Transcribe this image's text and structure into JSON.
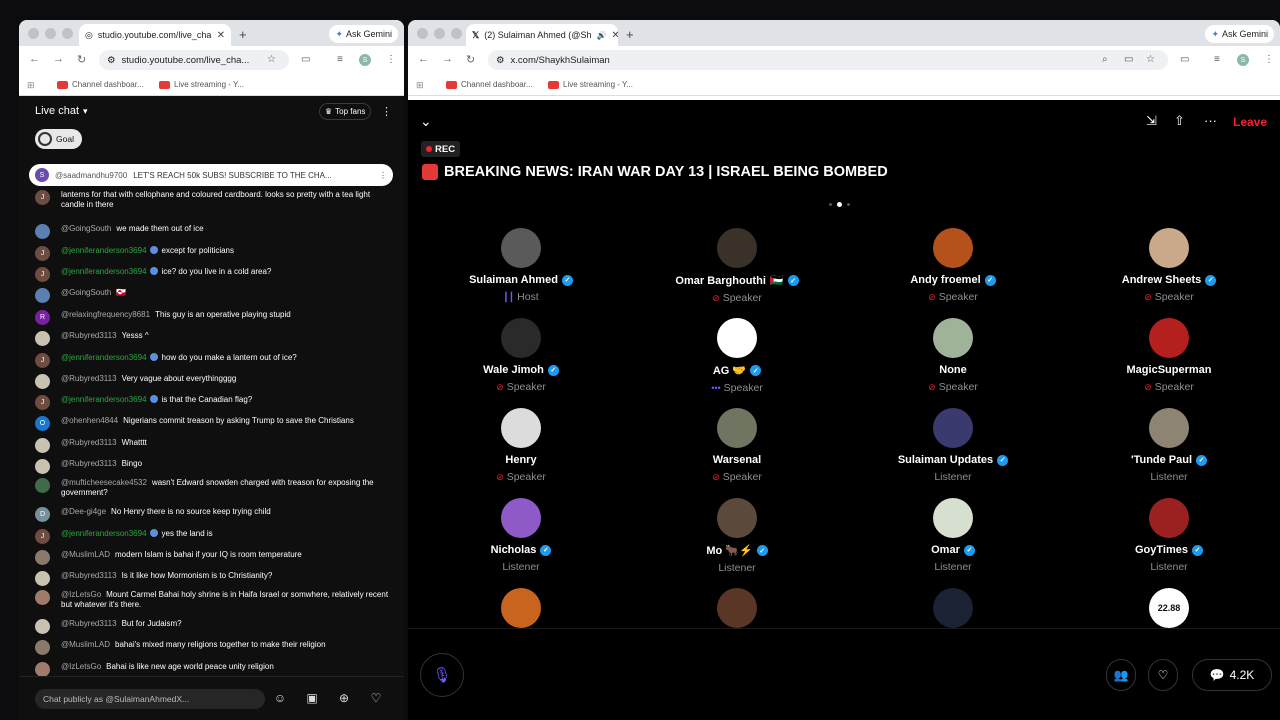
{
  "left_window": {
    "tab_title": "studio.youtube.com/live_cha",
    "ask_gemini": "Ask Gemini",
    "url": "studio.youtube.com/live_cha...",
    "bookmarks": [
      "Channel dashboar...",
      "Live streaming - Y..."
    ],
    "chat": {
      "header": "Live chat",
      "top_fans": "Top fans",
      "goal": "Goal",
      "pinned_user": "@saadmandhu9700",
      "pinned_text": "LET'S REACH 50k SUBS! SUBSCRIBE TO THE CHA...",
      "pinned_avatar": "S",
      "messages": [
        {
          "user": "",
          "text": "lanterns for that with cellophane and coloured cardboard. looks so pretty with a tea light candle in there",
          "avatar": "J",
          "color": "#6d4c41",
          "member": false
        },
        {
          "user": "@GoingSouth",
          "text": "we made them out of ice",
          "avatar": "",
          "color": "#5a7fb0",
          "member": false
        },
        {
          "user": "@jenniferanderson3694",
          "text": "except for politicians",
          "avatar": "J",
          "color": "#6d4c41",
          "member": true
        },
        {
          "user": "@jenniferanderson3694",
          "text": "ice? do you live in a cold area?",
          "avatar": "J",
          "color": "#6d4c41",
          "member": true
        },
        {
          "user": "@GoingSouth",
          "text": "🇬🇱",
          "avatar": "",
          "color": "#5a7fb0",
          "member": false
        },
        {
          "user": "@relaxingfrequency8681",
          "text": "This guy is an operative playing stupid",
          "avatar": "R",
          "color": "#7b1fa2",
          "member": false
        },
        {
          "user": "@Rubyred3113",
          "text": "Yesss ^",
          "avatar": "",
          "color": "#c9c2b0",
          "member": false
        },
        {
          "user": "@jenniferanderson3694",
          "text": "how do you make a lantern out of ice?",
          "avatar": "J",
          "color": "#6d4c41",
          "member": true
        },
        {
          "user": "@Rubyred3113",
          "text": "Very vague about everythingggg",
          "avatar": "",
          "color": "#c9c2b0",
          "member": false
        },
        {
          "user": "@jenniferanderson3694",
          "text": "is that the Canadian flag?",
          "avatar": "J",
          "color": "#6d4c41",
          "member": true
        },
        {
          "user": "@ohenhen4844",
          "text": "Nigerians commit treason by asking Trump to save the Christians",
          "avatar": "O",
          "color": "#1976d2",
          "member": false
        },
        {
          "user": "@Rubyred3113",
          "text": "Whatttt",
          "avatar": "",
          "color": "#c9c2b0",
          "member": false
        },
        {
          "user": "@Rubyred3113",
          "text": "Bingo",
          "avatar": "",
          "color": "#c9c2b0",
          "member": false
        },
        {
          "user": "@mufticheesecake4532",
          "text": "wasn't Edward snowden charged with treason for exposing the government?",
          "avatar": "",
          "color": "#3f6b4a",
          "member": false
        },
        {
          "user": "@Dee-gi4ge",
          "text": "No Henry there is no source keep trying child",
          "avatar": "D",
          "color": "#78909c",
          "member": false
        },
        {
          "user": "@jenniferanderson3694",
          "text": "yes the land is",
          "avatar": "J",
          "color": "#6d4c41",
          "member": true
        },
        {
          "user": "@MuslimLAD",
          "text": "modern Islam is bahai if your IQ is room temperature",
          "avatar": "",
          "color": "#8a7a6a",
          "member": false
        },
        {
          "user": "@Rubyred3113",
          "text": "Is it like how Mormonism is to Christianity?",
          "avatar": "",
          "color": "#c9c2b0",
          "member": false
        },
        {
          "user": "@IzLetsGo",
          "text": "Mount Carmel Bahai holy shrine is in Haifa Israel or somwhere, relatively recent but whatever it's there.",
          "avatar": "",
          "color": "#9e7b6a",
          "member": false
        },
        {
          "user": "@Rubyred3113",
          "text": "But for Judaism?",
          "avatar": "",
          "color": "#c9c2b0",
          "member": false
        },
        {
          "user": "@MuslimLAD",
          "text": "bahai's mixed many religions together to make their religion",
          "avatar": "",
          "color": "#8a7a6a",
          "member": false
        },
        {
          "user": "@IzLetsGo",
          "text": "Bahai is like new age world peace unity religion",
          "avatar": "",
          "color": "#9e7b6a",
          "member": false
        }
      ],
      "input_placeholder": "Chat publicly as @SulaimanAhmedX..."
    }
  },
  "right_window": {
    "tab_title": "(2) Sulaiman Ahmed (@Sh",
    "ask_gemini": "Ask Gemini",
    "url": "x.com/ShaykhSulaiman",
    "bookmarks": [
      "Channel dashboar...",
      "Live streaming - Y..."
    ],
    "space": {
      "leave": "Leave",
      "rec": "REC",
      "title": "BREAKING NEWS: IRAN WAR DAY 13 | ISRAEL BEING BOMBED",
      "participants": [
        {
          "name": "Sulaiman Ahmed",
          "role": "Host",
          "verified": true,
          "flag": "",
          "icon": "host",
          "color": "#5a5a5a"
        },
        {
          "name": "Omar Barghouthi",
          "role": "Speaker",
          "verified": true,
          "flag": "🇵🇸",
          "icon": "muted",
          "color": "#3a3128"
        },
        {
          "name": "Andy froemel",
          "role": "Speaker",
          "verified": true,
          "flag": "",
          "icon": "muted",
          "color": "#b5521c"
        },
        {
          "name": "Andrew Sheets",
          "role": "Speaker",
          "verified": true,
          "flag": "",
          "icon": "muted",
          "color": "#c9a98a"
        },
        {
          "name": "Wale Jimoh",
          "role": "Speaker",
          "verified": true,
          "flag": "",
          "icon": "muted",
          "color": "#2a2a2a"
        },
        {
          "name": "AG 🤝",
          "role": "Speaker",
          "verified": true,
          "flag": "",
          "icon": "dots",
          "color": "#ffffff"
        },
        {
          "name": "None",
          "role": "Speaker",
          "verified": false,
          "flag": "",
          "icon": "muted",
          "color": "#9fb39a"
        },
        {
          "name": "MagicSuperman",
          "role": "Speaker",
          "verified": false,
          "flag": "",
          "icon": "muted",
          "color": "#b3201e"
        },
        {
          "name": "Henry",
          "role": "Speaker",
          "verified": false,
          "flag": "",
          "icon": "muted",
          "color": "#dcdcdc"
        },
        {
          "name": "Warsenal",
          "role": "Speaker",
          "verified": false,
          "flag": "",
          "icon": "muted",
          "color": "#6f7560"
        },
        {
          "name": "Sulaiman Updates",
          "role": "Listener",
          "verified": true,
          "flag": "",
          "icon": "",
          "color": "#3b3a6e"
        },
        {
          "name": "'Tunde Paul",
          "role": "Listener",
          "verified": true,
          "flag": "",
          "icon": "",
          "color": "#8d8474"
        },
        {
          "name": "Nicholas",
          "role": "Listener",
          "verified": true,
          "flag": "",
          "icon": "",
          "color": "#8e5ac8"
        },
        {
          "name": "Mo 🐂⚡",
          "role": "Listener",
          "verified": true,
          "flag": "",
          "icon": "",
          "color": "#5b4a3c"
        },
        {
          "name": "Omar",
          "role": "Listener",
          "verified": true,
          "flag": "",
          "icon": "",
          "color": "#d7dfd0"
        },
        {
          "name": "GoyTimes",
          "role": "Listener",
          "verified": true,
          "flag": "",
          "icon": "",
          "color": "#9b2121"
        }
      ],
      "partial_avatars": [
        {
          "label": "",
          "color": "#c8641e"
        },
        {
          "label": "",
          "color": "#5a3626"
        },
        {
          "label": "",
          "color": "#1a2233"
        },
        {
          "label": "22.88",
          "color": "#ffffff"
        }
      ],
      "comments_count": "4.2K"
    }
  }
}
